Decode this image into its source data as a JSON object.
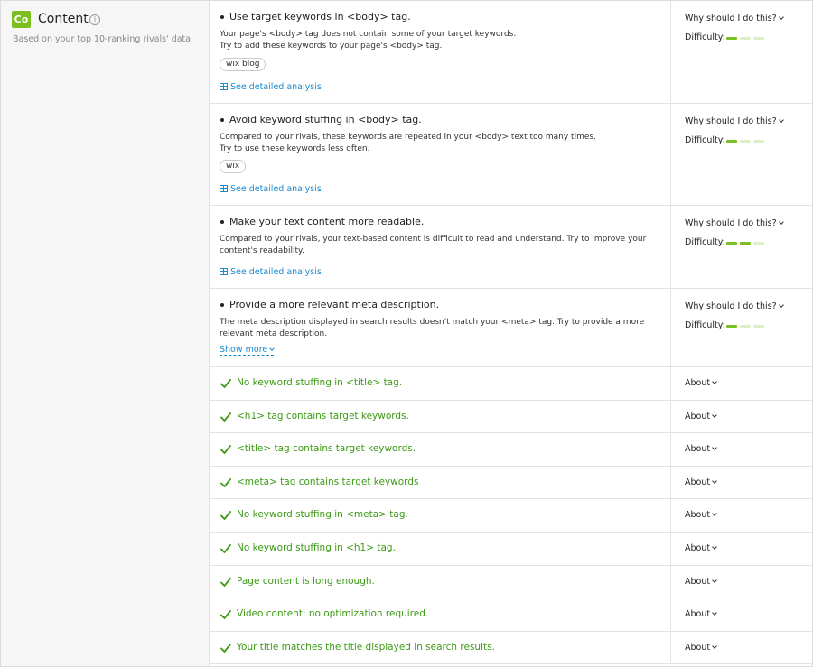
{
  "section": {
    "badge": "Co",
    "title": "Content",
    "subtitle": "Based on your top 10-ranking rivals' data"
  },
  "labels": {
    "why": "Why should I do this?",
    "difficulty": "Difficulty:",
    "analysis": "See detailed analysis",
    "show_more": "Show more",
    "about": "About"
  },
  "recommendations": [
    {
      "title": "Use target keywords in <body> tag.",
      "desc1": "Your page's <body> tag does not contain some of your target keywords.",
      "desc2": "Try to add these keywords to your page's <body> tag.",
      "tag": "wix blog",
      "difficulty": 1
    },
    {
      "title": "Avoid keyword stuffing in <body> tag.",
      "desc1": "Compared to your rivals, these keywords are repeated in your <body> text too many times.",
      "desc2": "Try to use these keywords less often.",
      "tag": "wix",
      "difficulty": 1
    },
    {
      "title": "Make your text content more readable.",
      "desc1": "Compared to your rivals, your text-based content is difficult to read and understand. Try to improve your content's readability.",
      "difficulty": 2
    },
    {
      "title": "Provide a more relevant meta description.",
      "desc1": "The meta description displayed in search results doesn't match your <meta> tag. Try to provide a more relevant meta description.",
      "difficulty": 1
    }
  ],
  "passed": [
    "No keyword stuffing in <title> tag.",
    "<h1> tag contains target keywords.",
    "<title> tag contains target keywords.",
    "<meta> tag contains target keywords",
    "No keyword stuffing in <meta> tag.",
    "No keyword stuffing in <h1> tag.",
    "Page content is long enough.",
    "Video content: no optimization required.",
    "Your title matches the title displayed in search results."
  ]
}
